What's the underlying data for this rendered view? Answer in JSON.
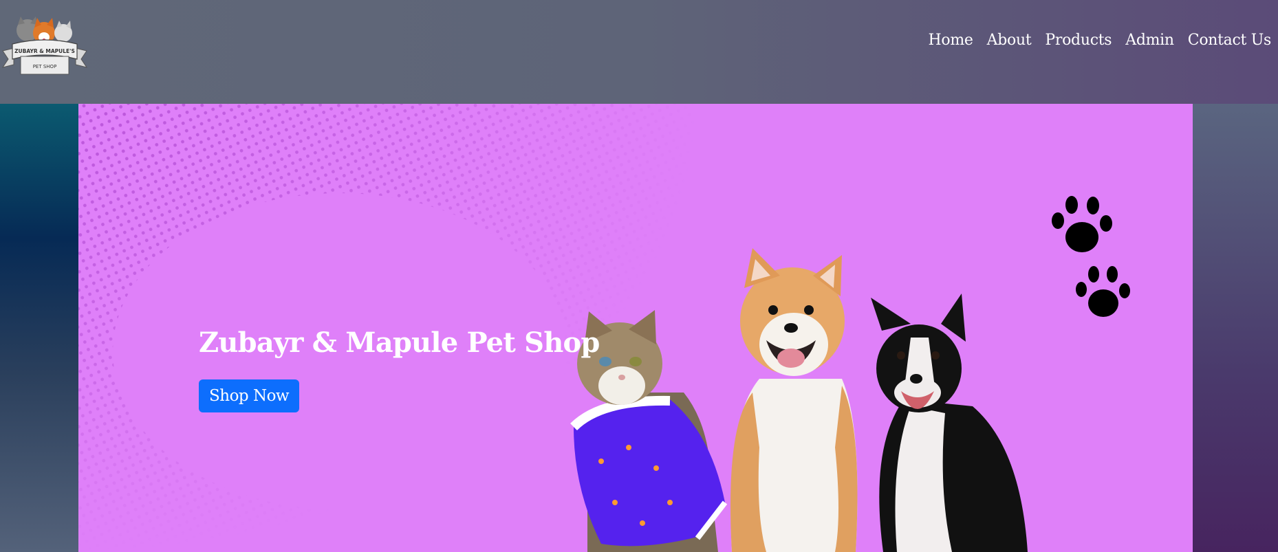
{
  "logo": {
    "line1": "ZUBAYR & MAPULE'S",
    "line2": "PET SHOP"
  },
  "nav": {
    "items": [
      {
        "label": "Home"
      },
      {
        "label": "About"
      },
      {
        "label": "Products"
      },
      {
        "label": "Admin"
      },
      {
        "label": "Contact Us"
      }
    ]
  },
  "hero": {
    "title": "Zubayr & Mapule Pet Shop",
    "button_label": "Shop Now"
  },
  "colors": {
    "hero_bg": "#df80f9",
    "button": "#0d6efd"
  }
}
